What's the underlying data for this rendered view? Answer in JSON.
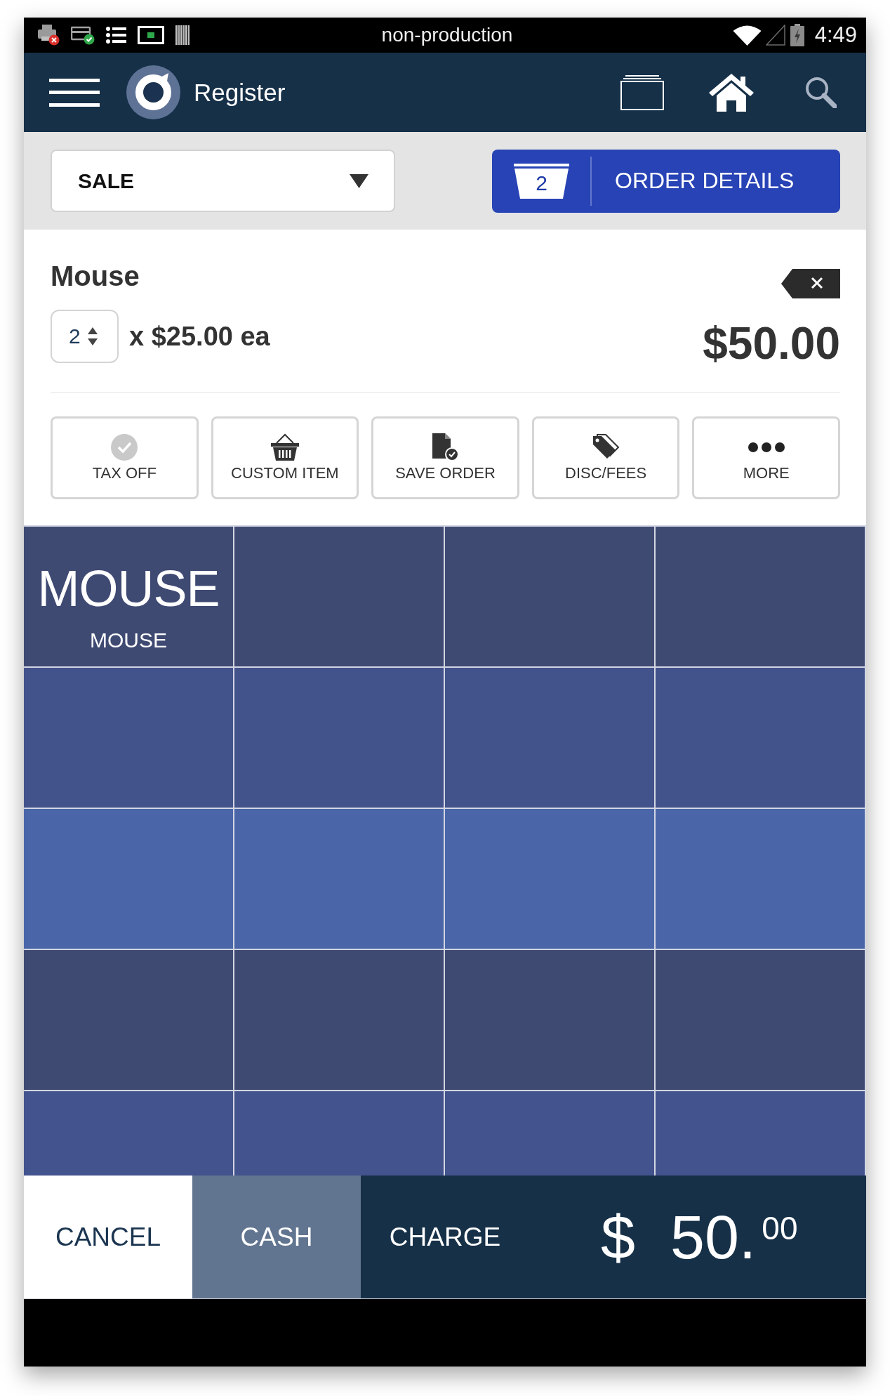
{
  "status_bar": {
    "title": "non-production",
    "time": "4:49"
  },
  "header": {
    "title": "Register"
  },
  "toolbar": {
    "mode_select": {
      "value": "SALE"
    },
    "order_button": {
      "count": "2",
      "label": "ORDER DETAILS"
    }
  },
  "line_item": {
    "name": "Mouse",
    "quantity": "2",
    "unit_price": "x $25.00 ea",
    "total": "$50.00"
  },
  "actions": [
    {
      "label": "TAX OFF"
    },
    {
      "label": "CUSTOM ITEM"
    },
    {
      "label": "SAVE ORDER"
    },
    {
      "label": "DISC/FEES"
    },
    {
      "label": "MORE"
    }
  ],
  "product_grid": {
    "rows": [
      {
        "color": "#3f4a73",
        "tiles": [
          {
            "kind": "product",
            "title": "MOUSE",
            "subtitle": "MOUSE"
          },
          {
            "kind": "empty"
          },
          {
            "kind": "empty"
          },
          {
            "kind": "empty"
          }
        ]
      },
      {
        "color": "#42528b",
        "tiles": [
          {
            "kind": "empty"
          },
          {
            "kind": "empty"
          },
          {
            "kind": "empty"
          },
          {
            "kind": "empty"
          }
        ]
      },
      {
        "color": "#4a66a8",
        "tiles": [
          {
            "kind": "empty"
          },
          {
            "kind": "empty"
          },
          {
            "kind": "empty"
          },
          {
            "kind": "empty"
          }
        ]
      },
      {
        "color": "#3f4a73",
        "tiles": [
          {
            "kind": "empty"
          },
          {
            "kind": "empty"
          },
          {
            "kind": "empty"
          },
          {
            "kind": "empty"
          }
        ]
      },
      {
        "color": "#43538d",
        "tiles": [
          {
            "kind": "empty"
          },
          {
            "kind": "empty"
          },
          {
            "kind": "empty"
          },
          {
            "kind": "empty"
          }
        ]
      }
    ]
  },
  "bottom_bar": {
    "cancel": "CANCEL",
    "cash": "CASH",
    "charge": "CHARGE",
    "total": {
      "currency": "$",
      "whole": "50.",
      "cents": "00"
    }
  }
}
